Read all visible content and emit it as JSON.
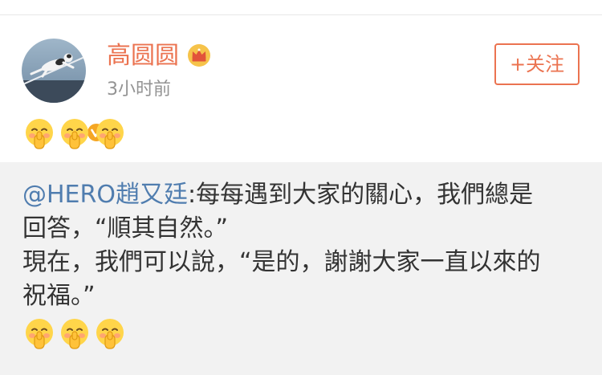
{
  "post": {
    "author": {
      "name": "高圆圆",
      "avatar_icon": "avatar-cat-photo-icon",
      "verified_icon": "verified-v-badge-icon",
      "vip_icon": "crown-icon"
    },
    "timestamp": "3小时前",
    "follow_label": "+关注",
    "emojis": [
      "shush-face-icon",
      "shush-face-icon",
      "shush-face-icon"
    ]
  },
  "quote": {
    "mention": "@HERO趙又廷",
    "lines": [
      ":每每遇到大家的關心，我們總是",
      "回答，“順其自然。”",
      "現在，我們可以說，“是的，謝謝大家一直以來的",
      "祝福。”"
    ],
    "emojis": [
      "shush-face-icon",
      "shush-face-icon",
      "shush-face-icon"
    ]
  },
  "colors": {
    "accent": "#eb7350",
    "link": "#507daf",
    "quote_bg": "#f2f2f2",
    "meta_text": "#939393",
    "body_text": "#333333"
  }
}
